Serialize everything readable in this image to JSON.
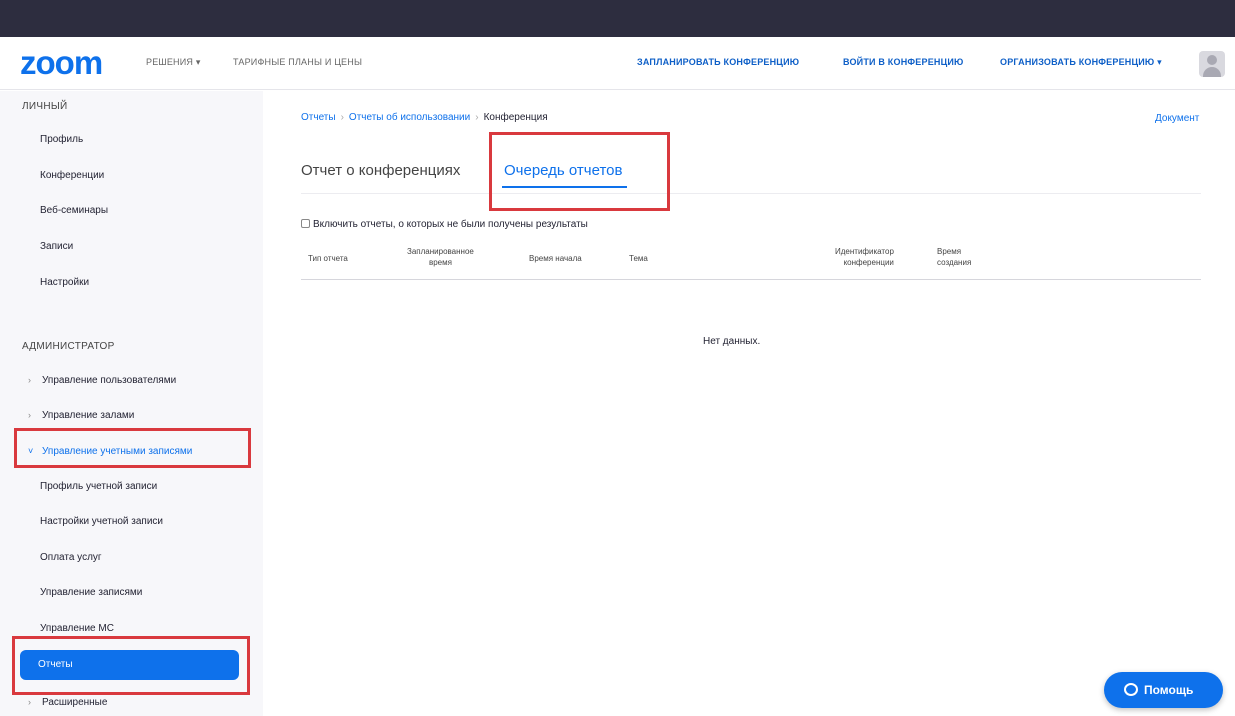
{
  "header": {
    "logo": "zoom",
    "nav_left": [
      "РЕШЕНИЯ ▾",
      "ТАРИФНЫЕ ПЛАНЫ И ЦЕНЫ"
    ],
    "nav_right": [
      "ЗАПЛАНИРОВАТЬ КОНФЕРЕНЦИЮ",
      "ВОЙТИ В КОНФЕРЕНЦИЮ",
      "ОРГАНИЗОВАТЬ КОНФЕРЕНЦИЮ ▾"
    ]
  },
  "sidebar": {
    "personal_heading": "ЛИЧНЫЙ",
    "personal_items": [
      "Профиль",
      "Конференции",
      "Веб-семинары",
      "Записи",
      "Настройки"
    ],
    "admin_heading": "АДМИНИСТРАТОР",
    "admin_groups": [
      "Управление пользователями",
      "Управление залами",
      "Управление учетными записями"
    ],
    "account_items": [
      "Профиль учетной записи",
      "Настройки учетной записи",
      "Оплата услуг",
      "Управление записями",
      "Управление МС",
      "Отчеты"
    ],
    "extended": "Расширенные"
  },
  "breadcrumb": {
    "items": [
      "Отчеты",
      "Отчеты об использовании",
      "Конференция"
    ]
  },
  "doc_link": "Документ",
  "tabs": [
    "Отчет о конференциях",
    "Очередь отчетов"
  ],
  "checkbox_label": "Включить отчеты, о которых не были получены результаты",
  "table": {
    "headers": [
      [
        "Тип отчета"
      ],
      [
        "Запланированное",
        "время"
      ],
      [
        "Время начала"
      ],
      [
        "Тема"
      ],
      [
        "Идентификатор",
        "конференции"
      ],
      [
        "Время",
        "создания"
      ]
    ],
    "empty_text": "Нет данных."
  },
  "help_button": "Помощь",
  "colors": {
    "brand_blue": "#0e71eb",
    "highlight_red": "#d9393e",
    "sidebar_bg": "#f7f7fa"
  }
}
